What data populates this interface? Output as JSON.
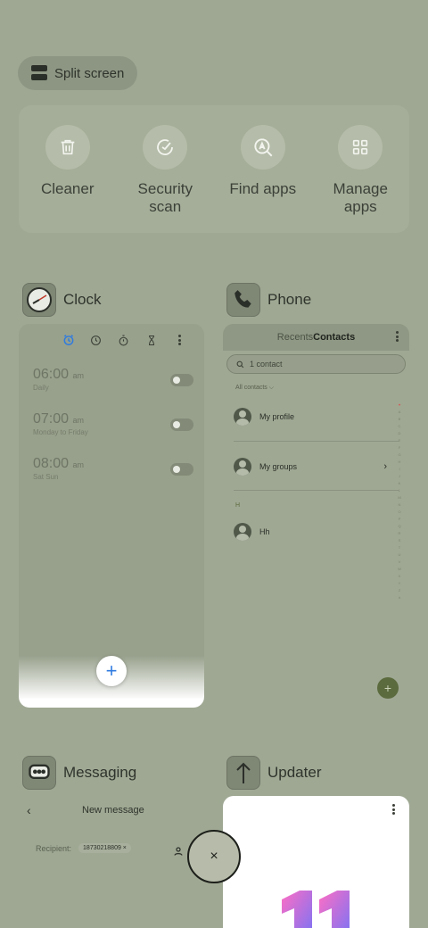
{
  "split_screen": {
    "label": "Split screen"
  },
  "quick_actions": [
    {
      "label": "Cleaner",
      "icon": "trash-icon"
    },
    {
      "label": "Security scan",
      "icon": "shield-check-icon"
    },
    {
      "label": "Find apps",
      "icon": "search-apps-icon"
    },
    {
      "label": "Manage apps",
      "icon": "grid-icon"
    }
  ],
  "apps": {
    "clock": {
      "name": "Clock",
      "alarms": [
        {
          "time": "06:00",
          "ampm": "am",
          "repeat": "Daily"
        },
        {
          "time": "07:00",
          "ampm": "am",
          "repeat": "Monday to Friday"
        },
        {
          "time": "08:00",
          "ampm": "am",
          "repeat": "Sat Sun"
        }
      ],
      "fab_label": "+"
    },
    "phone": {
      "name": "Phone",
      "tabs": {
        "recents": "Recents",
        "contacts": "Contacts"
      },
      "search_placeholder": "1 contact",
      "filter": "All contacts",
      "contacts": [
        {
          "label": "My profile"
        },
        {
          "label": "My groups"
        },
        {
          "section": "H",
          "label": "Hh"
        }
      ],
      "index_letters": [
        "♥",
        "A",
        "B",
        "C",
        "D",
        "E",
        "F",
        "G",
        "H",
        "I",
        "J",
        "K",
        "L",
        "M",
        "N",
        "O",
        "P",
        "Q",
        "R",
        "S",
        "T",
        "U",
        "V",
        "W",
        "X",
        "Y",
        "Z",
        "#"
      ],
      "fab_label": "+"
    },
    "messaging": {
      "name": "Messaging",
      "title": "New message",
      "recipient_label": "Recipient:",
      "recipient_value": "18730218809"
    },
    "updater": {
      "name": "Updater"
    }
  },
  "close_button": {
    "label": "×"
  },
  "colors": {
    "background": "#9fa893",
    "accent_blue": "#2f7be0",
    "phone_fab": "#5c6b3e"
  }
}
